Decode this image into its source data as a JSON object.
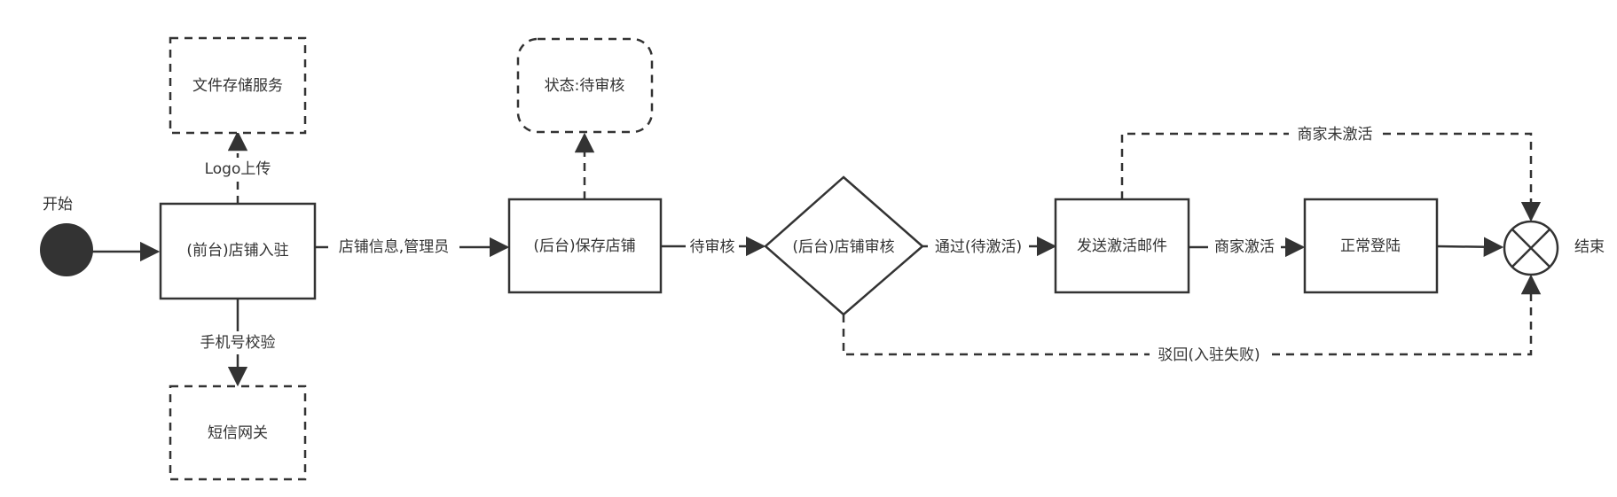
{
  "colors": {
    "stroke": "#333333",
    "fill_start": "#333333",
    "background": "#ffffff"
  },
  "labels": {
    "start": "开始",
    "end": "结束"
  },
  "nodes": {
    "front_register": "(前台)店铺入驻",
    "file_storage": "文件存储服务",
    "sms_gateway": "短信网关",
    "backend_save": "(后台)保存店铺",
    "status_pending": "状态:待审核",
    "backend_review": "(后台)店铺审核",
    "send_email": "发送激活邮件",
    "normal_login": "正常登陆"
  },
  "edges": {
    "logo_upload": "Logo上传",
    "phone_verify": "手机号校验",
    "store_info": "店铺信息,管理员",
    "pending_review": "待审核",
    "approved": "通过(待激活)",
    "merchant_activated": "商家激活",
    "merchant_not_activated": "商家未激活",
    "rejected": "驳回(入驻失败)"
  },
  "icons": {
    "end": "circle-x-end-icon",
    "start": "filled-circle-start-icon"
  }
}
